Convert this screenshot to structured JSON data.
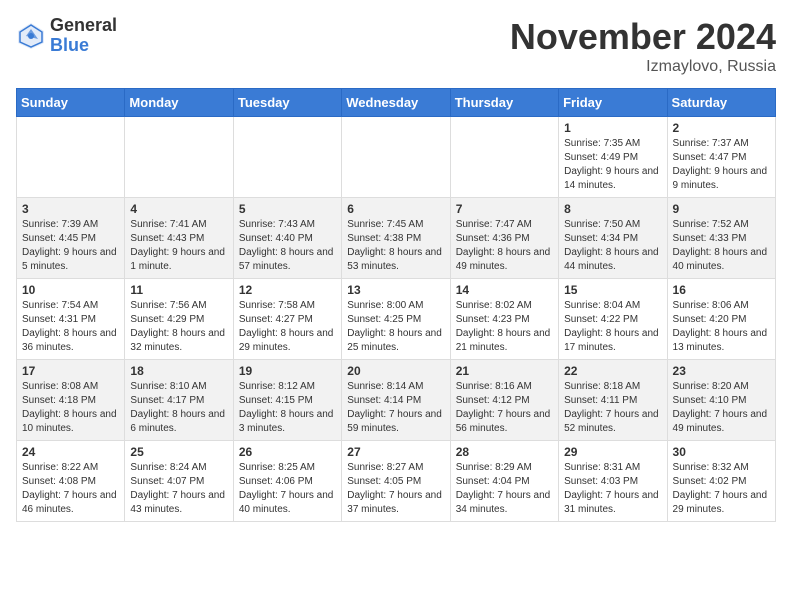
{
  "logo": {
    "general": "General",
    "blue": "Blue"
  },
  "title": "November 2024",
  "location": "Izmaylovo, Russia",
  "days_of_week": [
    "Sunday",
    "Monday",
    "Tuesday",
    "Wednesday",
    "Thursday",
    "Friday",
    "Saturday"
  ],
  "weeks": [
    [
      {
        "day": "",
        "sunrise": "",
        "sunset": "",
        "daylight": ""
      },
      {
        "day": "",
        "sunrise": "",
        "sunset": "",
        "daylight": ""
      },
      {
        "day": "",
        "sunrise": "",
        "sunset": "",
        "daylight": ""
      },
      {
        "day": "",
        "sunrise": "",
        "sunset": "",
        "daylight": ""
      },
      {
        "day": "",
        "sunrise": "",
        "sunset": "",
        "daylight": ""
      },
      {
        "day": "1",
        "sunrise": "Sunrise: 7:35 AM",
        "sunset": "Sunset: 4:49 PM",
        "daylight": "Daylight: 9 hours and 14 minutes."
      },
      {
        "day": "2",
        "sunrise": "Sunrise: 7:37 AM",
        "sunset": "Sunset: 4:47 PM",
        "daylight": "Daylight: 9 hours and 9 minutes."
      }
    ],
    [
      {
        "day": "3",
        "sunrise": "Sunrise: 7:39 AM",
        "sunset": "Sunset: 4:45 PM",
        "daylight": "Daylight: 9 hours and 5 minutes."
      },
      {
        "day": "4",
        "sunrise": "Sunrise: 7:41 AM",
        "sunset": "Sunset: 4:43 PM",
        "daylight": "Daylight: 9 hours and 1 minute."
      },
      {
        "day": "5",
        "sunrise": "Sunrise: 7:43 AM",
        "sunset": "Sunset: 4:40 PM",
        "daylight": "Daylight: 8 hours and 57 minutes."
      },
      {
        "day": "6",
        "sunrise": "Sunrise: 7:45 AM",
        "sunset": "Sunset: 4:38 PM",
        "daylight": "Daylight: 8 hours and 53 minutes."
      },
      {
        "day": "7",
        "sunrise": "Sunrise: 7:47 AM",
        "sunset": "Sunset: 4:36 PM",
        "daylight": "Daylight: 8 hours and 49 minutes."
      },
      {
        "day": "8",
        "sunrise": "Sunrise: 7:50 AM",
        "sunset": "Sunset: 4:34 PM",
        "daylight": "Daylight: 8 hours and 44 minutes."
      },
      {
        "day": "9",
        "sunrise": "Sunrise: 7:52 AM",
        "sunset": "Sunset: 4:33 PM",
        "daylight": "Daylight: 8 hours and 40 minutes."
      }
    ],
    [
      {
        "day": "10",
        "sunrise": "Sunrise: 7:54 AM",
        "sunset": "Sunset: 4:31 PM",
        "daylight": "Daylight: 8 hours and 36 minutes."
      },
      {
        "day": "11",
        "sunrise": "Sunrise: 7:56 AM",
        "sunset": "Sunset: 4:29 PM",
        "daylight": "Daylight: 8 hours and 32 minutes."
      },
      {
        "day": "12",
        "sunrise": "Sunrise: 7:58 AM",
        "sunset": "Sunset: 4:27 PM",
        "daylight": "Daylight: 8 hours and 29 minutes."
      },
      {
        "day": "13",
        "sunrise": "Sunrise: 8:00 AM",
        "sunset": "Sunset: 4:25 PM",
        "daylight": "Daylight: 8 hours and 25 minutes."
      },
      {
        "day": "14",
        "sunrise": "Sunrise: 8:02 AM",
        "sunset": "Sunset: 4:23 PM",
        "daylight": "Daylight: 8 hours and 21 minutes."
      },
      {
        "day": "15",
        "sunrise": "Sunrise: 8:04 AM",
        "sunset": "Sunset: 4:22 PM",
        "daylight": "Daylight: 8 hours and 17 minutes."
      },
      {
        "day": "16",
        "sunrise": "Sunrise: 8:06 AM",
        "sunset": "Sunset: 4:20 PM",
        "daylight": "Daylight: 8 hours and 13 minutes."
      }
    ],
    [
      {
        "day": "17",
        "sunrise": "Sunrise: 8:08 AM",
        "sunset": "Sunset: 4:18 PM",
        "daylight": "Daylight: 8 hours and 10 minutes."
      },
      {
        "day": "18",
        "sunrise": "Sunrise: 8:10 AM",
        "sunset": "Sunset: 4:17 PM",
        "daylight": "Daylight: 8 hours and 6 minutes."
      },
      {
        "day": "19",
        "sunrise": "Sunrise: 8:12 AM",
        "sunset": "Sunset: 4:15 PM",
        "daylight": "Daylight: 8 hours and 3 minutes."
      },
      {
        "day": "20",
        "sunrise": "Sunrise: 8:14 AM",
        "sunset": "Sunset: 4:14 PM",
        "daylight": "Daylight: 7 hours and 59 minutes."
      },
      {
        "day": "21",
        "sunrise": "Sunrise: 8:16 AM",
        "sunset": "Sunset: 4:12 PM",
        "daylight": "Daylight: 7 hours and 56 minutes."
      },
      {
        "day": "22",
        "sunrise": "Sunrise: 8:18 AM",
        "sunset": "Sunset: 4:11 PM",
        "daylight": "Daylight: 7 hours and 52 minutes."
      },
      {
        "day": "23",
        "sunrise": "Sunrise: 8:20 AM",
        "sunset": "Sunset: 4:10 PM",
        "daylight": "Daylight: 7 hours and 49 minutes."
      }
    ],
    [
      {
        "day": "24",
        "sunrise": "Sunrise: 8:22 AM",
        "sunset": "Sunset: 4:08 PM",
        "daylight": "Daylight: 7 hours and 46 minutes."
      },
      {
        "day": "25",
        "sunrise": "Sunrise: 8:24 AM",
        "sunset": "Sunset: 4:07 PM",
        "daylight": "Daylight: 7 hours and 43 minutes."
      },
      {
        "day": "26",
        "sunrise": "Sunrise: 8:25 AM",
        "sunset": "Sunset: 4:06 PM",
        "daylight": "Daylight: 7 hours and 40 minutes."
      },
      {
        "day": "27",
        "sunrise": "Sunrise: 8:27 AM",
        "sunset": "Sunset: 4:05 PM",
        "daylight": "Daylight: 7 hours and 37 minutes."
      },
      {
        "day": "28",
        "sunrise": "Sunrise: 8:29 AM",
        "sunset": "Sunset: 4:04 PM",
        "daylight": "Daylight: 7 hours and 34 minutes."
      },
      {
        "day": "29",
        "sunrise": "Sunrise: 8:31 AM",
        "sunset": "Sunset: 4:03 PM",
        "daylight": "Daylight: 7 hours and 31 minutes."
      },
      {
        "day": "30",
        "sunrise": "Sunrise: 8:32 AM",
        "sunset": "Sunset: 4:02 PM",
        "daylight": "Daylight: 7 hours and 29 minutes."
      }
    ]
  ]
}
